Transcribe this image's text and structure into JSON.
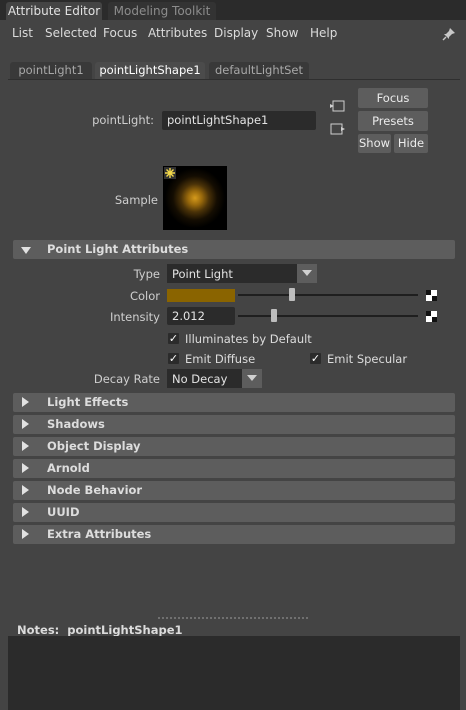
{
  "panel_tabs": [
    {
      "label": "Attribute Editor",
      "active": true
    },
    {
      "label": "Modeling Toolkit",
      "active": false
    }
  ],
  "menu": [
    "List",
    "Selected",
    "Focus",
    "Attributes",
    "Display",
    "Show",
    "Help"
  ],
  "node_tabs": [
    {
      "label": "pointLight1",
      "active": false
    },
    {
      "label": "pointLightShape1",
      "active": true
    },
    {
      "label": "defaultLightSet",
      "active": false
    }
  ],
  "node_type_label": "pointLight:",
  "node_name": "pointLightShape1",
  "buttons": {
    "focus": "Focus",
    "presets": "Presets",
    "show": "Show",
    "hide": "Hide"
  },
  "sample_label": "Sample",
  "sections": {
    "point_light": "Point Light Attributes",
    "collapsed": [
      "Light Effects",
      "Shadows",
      "Object Display",
      "Arnold",
      "Node Behavior",
      "UUID",
      "Extra Attributes"
    ]
  },
  "attributes": {
    "type_label": "Type",
    "type_value": "Point Light",
    "color_label": "Color",
    "color_value": "#8a6400",
    "color_slider_fraction": 0.3,
    "intensity_label": "Intensity",
    "intensity_value": "2.012",
    "intensity_slider_fraction": 0.2,
    "illuminates_label": "Illuminates by Default",
    "emit_diffuse_label": "Emit Diffuse",
    "emit_specular_label": "Emit Specular",
    "decay_label": "Decay Rate",
    "decay_value": "No Decay"
  },
  "notes": {
    "label": "Notes:",
    "node": "pointLightShape1"
  }
}
